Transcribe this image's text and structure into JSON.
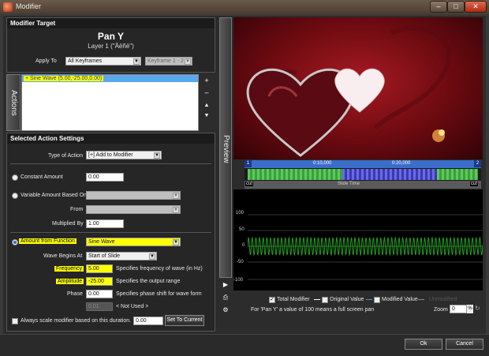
{
  "window": {
    "title": "Modifier",
    "min": "–",
    "max": "□",
    "close": "✕"
  },
  "modifier_target": {
    "header": "Modifier Target",
    "name": "Pan Y",
    "layer": "Layer 1 (\"Äëñë\")",
    "apply_to_label": "Apply To",
    "apply_to_value": "All Keyframes",
    "keyframe_value": "Keyframe 1 - 2"
  },
  "actions": {
    "tab_label": "Actions",
    "items": [
      "+ Sine Wave (5.00,-25.00,0.00)"
    ],
    "add": "+",
    "remove": "–",
    "up": "▲",
    "down": "▼"
  },
  "settings": {
    "header": "Selected Action Settings",
    "type_label": "Type of Action",
    "type_value": "[+] Add to Modifier",
    "constant_label": "Constant Amount",
    "constant_value": "0.00",
    "variable_label": "Variable Amount Based On",
    "variable_value": "",
    "from_label": "From",
    "from_value": "",
    "multiplied_label": "Multiplied By",
    "multiplied_value": "1.00",
    "function_label": "Amount from Function",
    "function_value": "Sine Wave",
    "wave_begins_label": "Wave Begins At",
    "wave_begins_value": "Start of Slide",
    "frequency_label": "Frequency",
    "frequency_value": "5.00",
    "frequency_desc": "Specifies frequency of wave (in Hz)",
    "amplitude_label": "Amplitude",
    "amplitude_value": "-25.00",
    "amplitude_desc": "Specifies the output range",
    "phase_label": "Phase",
    "phase_value": "0.00",
    "phase_desc": "Specifies phase shift for wave form",
    "unused_value": "0.01",
    "unused_desc": "< Not Used >",
    "always_scale_label": "Always scale modifier based on this duration.",
    "always_scale_value": "0.00",
    "set_current": "Set To Current"
  },
  "preview": {
    "tab_label": "Preview",
    "timeline_start": "1",
    "timeline_end": "2",
    "time_mark_1": "0:10,000",
    "time_mark_2": "0:20,000",
    "cut_left": "cut",
    "cut_right": "cut",
    "slide_time": "Slide Time"
  },
  "graph": {
    "y_ticks": [
      "100",
      "50",
      "0",
      "-50",
      "-100"
    ],
    "legend": {
      "total": "Total Modifier",
      "original": "Original Value",
      "modified": "Modified Value",
      "unmodified": "Unmodified"
    },
    "note": "For 'Pan Y' a value of 100 means a full screen pan",
    "zoom_label": "Zoom",
    "zoom_value": "0",
    "zoom_unit": "%",
    "colors": {
      "wave": "#1fa11f",
      "total": "#ffffff"
    }
  },
  "footer": {
    "ok": "Ok",
    "cancel": "Cancel"
  }
}
